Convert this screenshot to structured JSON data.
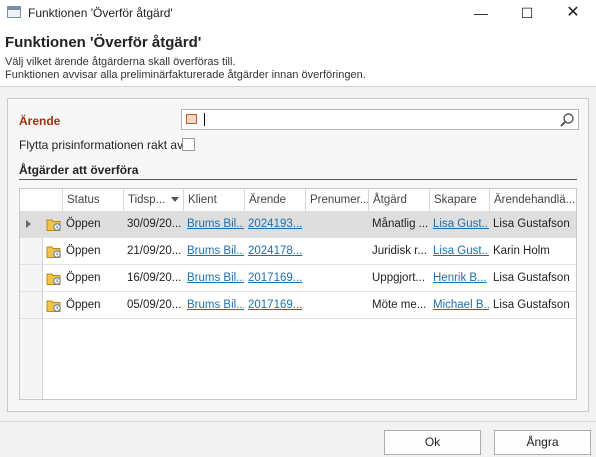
{
  "window": {
    "title": "Funktionen 'Överför åtgärd'"
  },
  "header": {
    "heading": "Funktionen 'Överför åtgärd'",
    "desc1": "Välj vilket ärende åtgärderna skall överföras till.",
    "desc2": "Funktionen avvisar alla preliminärfakturerade åtgärder innan överföringen."
  },
  "form": {
    "arende_label": "Ärende",
    "arende_value": "",
    "flytta_label": "Flytta prisinformationen rakt av",
    "flytta_checked": false
  },
  "section": {
    "title": "Åtgärder att överföra"
  },
  "grid": {
    "columns": [
      "Status",
      "Tidsp...",
      "Klient",
      "Ärende",
      "Prenumer...",
      "Åtgärd",
      "Skapare",
      "Ärendehandlä..."
    ],
    "sorted_column": "Tidsp...",
    "rows": [
      {
        "status": "Öppen",
        "tidsp": "30/09/20...",
        "klient": "Brums Bil...",
        "arende": "2024193...",
        "prenumer": "",
        "atgard": "Månatlig ...",
        "skapare": "Lisa Gust...",
        "handlaggare": "Lisa Gustafson",
        "selected": true
      },
      {
        "status": "Öppen",
        "tidsp": "21/09/20...",
        "klient": "Brums Bil...",
        "arende": "2024178...",
        "prenumer": "",
        "atgard": "Juridisk r...",
        "skapare": "Lisa Gust...",
        "handlaggare": "Karin Holm",
        "selected": false
      },
      {
        "status": "Öppen",
        "tidsp": "16/09/20...",
        "klient": "Brums Bil...",
        "arende": "2017169...",
        "prenumer": "",
        "atgard": "Uppgjort...",
        "skapare": "Henrik B...",
        "handlaggare": "Lisa Gustafson",
        "selected": false
      },
      {
        "status": "Öppen",
        "tidsp": "05/09/20...",
        "klient": "Brums Bil...",
        "arende": "2017169...",
        "prenumer": "",
        "atgard": "Möte me...",
        "skapare": "Michael B...",
        "handlaggare": "Lisa Gustafson",
        "selected": false
      }
    ]
  },
  "footer": {
    "ok_label": "Ok",
    "cancel_label": "Ångra"
  },
  "colors": {
    "accent_label": "#a0300f",
    "link": "#1f6fa8",
    "selected_row": "#dedede"
  }
}
